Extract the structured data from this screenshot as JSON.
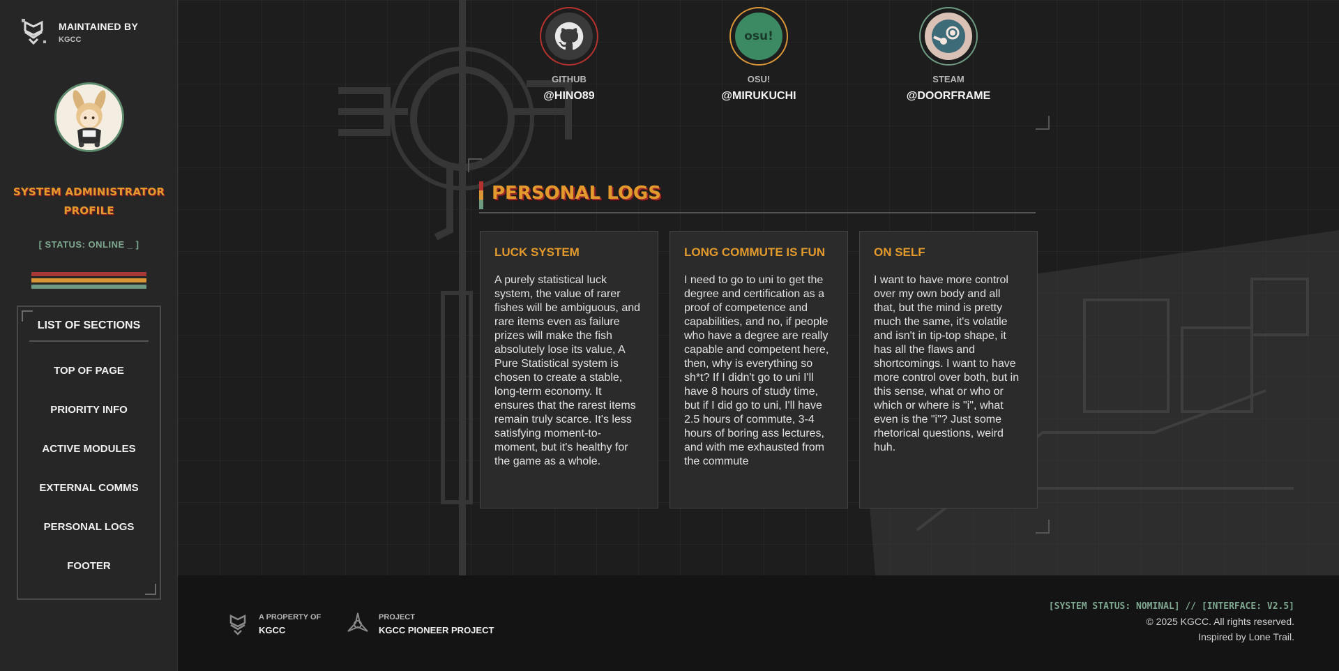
{
  "sidebar": {
    "maintained_label": "MAINTAINED BY",
    "maintained_name": "KGCC",
    "title": "SYSTEM ADMINISTRATOR PROFILE",
    "status": "[ STATUS: ONLINE _ ]",
    "stripe_colors": [
      "#a33a35",
      "#d99637",
      "#6e9a82"
    ],
    "sections_heading": "LIST OF SECTIONS",
    "nav": [
      {
        "label": "TOP OF PAGE"
      },
      {
        "label": "PRIORITY INFO"
      },
      {
        "label": "ACTIVE MODULES"
      },
      {
        "label": "EXTERNAL COMMS"
      },
      {
        "label": "PERSONAL LOGS"
      },
      {
        "label": "FOOTER"
      }
    ]
  },
  "social": [
    {
      "label": "GITHUB",
      "handle": "@HINO89",
      "icon": "github-icon",
      "ring_color": "#b5322f"
    },
    {
      "label": "OSU!",
      "handle": "@MIRUKUCHI",
      "icon": "osu-icon",
      "icon_text": "osu!",
      "ring_color": "#d99637"
    },
    {
      "label": "STEAM",
      "handle": "@DOORFRAME",
      "icon": "steam-icon",
      "ring_color": "#6e9a82"
    }
  ],
  "logs": {
    "title": "PERSONAL LOGS",
    "entries": [
      {
        "title": "LUCK SYSTEM",
        "body": "A purely statistical luck system, the value of rarer fishes will be ambiguous, and rare items even as failure prizes will make the fish absolutely lose its value, A Pure Statistical system is chosen to create a stable, long-term economy. It ensures that the rarest items remain truly scarce. It's less satisfying moment-to-moment, but it's healthy for the game as a whole."
      },
      {
        "title": "LONG COMMUTE IS FUN",
        "body": "I need to go to uni to get the degree and certification as a proof of competence and capabilities, and no, if people who have a degree are really capable and competent here, then, why is everything so sh*t? If I didn't go to uni I'll have 8 hours of study time, but if I did go to uni, I'll have 2.5 hours of commute, 3-4 hours of boring ass lectures, and with me exhausted from the commute"
      },
      {
        "title": "ON SELF",
        "body": "I want to have more control over my own body and all that, but the mind is pretty much the same, it's volatile and isn't in tip-top shape, it has all the flaws and shortcomings. I want to have more control over both, but in this sense, what or who or which or where is \"i\", what even is the \"i\"? Just some rhetorical questions, weird huh."
      }
    ]
  },
  "footer": {
    "property_label": "A PROPERTY OF",
    "property_value": "KGCC",
    "project_label": "PROJECT",
    "project_value": "KGCC PIONEER PROJECT",
    "system_status": "[SYSTEM STATUS: NOMINAL] // [INTERFACE: V2.5]",
    "copyright": "© 2025 KGCC. All rights reserved.",
    "inspired": "Inspired by Lone Trail."
  }
}
